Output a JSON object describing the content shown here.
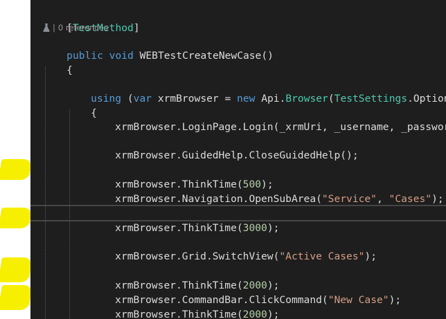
{
  "code": {
    "attribute": {
      "open": "[",
      "name": "TestMethod",
      "close": "]"
    },
    "codelens": {
      "separator": "|",
      "text": "0 references"
    },
    "signature": {
      "kw_public": "public",
      "kw_void": "void",
      "method": " WEBTestCreateNewCase()"
    },
    "brace_open_method": "{",
    "using_line": {
      "kw_using": "using",
      "p1": " (",
      "kw_var": "var",
      "p2": " xrmBrowser = ",
      "kw_new": "new",
      "p3": " Api.",
      "type_browser": "Browser",
      "p4": "(",
      "type_settings": "TestSettings",
      "p5": ".Options))"
    },
    "brace_open_using": "{",
    "lines": {
      "login": "xrmBrowser.LoginPage.Login(_xrmUri, _username, _password);",
      "guided_help": "xrmBrowser.GuidedHelp.CloseGuidedHelp();",
      "think1": {
        "pre": "xrmBrowser.ThinkTime(",
        "num": "500",
        "post": ");"
      },
      "navigation": {
        "pre": "xrmBrowser.Navigation.OpenSubArea(",
        "s1": "\"Service\"",
        "mid": ", ",
        "s2": "\"Cases\"",
        "post": ");"
      },
      "think2": {
        "pre": "xrmBrowser.ThinkTime(",
        "num": "3000",
        "post": ");"
      },
      "switch_view": {
        "pre": "xrmBrowser.Grid.SwitchView(",
        "s1": "\"Active Cases\"",
        "post": ");"
      },
      "think3": {
        "pre": "xrmBrowser.ThinkTime(",
        "num": "2000",
        "post": ");"
      },
      "click_command": {
        "pre": "xrmBrowser.CommandBar.ClickCommand(",
        "s1": "\"New Case\"",
        "post": ");"
      },
      "think4": {
        "pre": "xrmBrowser.ThinkTime(",
        "num": "2000",
        "post": ");"
      }
    }
  },
  "colors": {
    "background": "#1e1e1e",
    "keyword": "#569cd6",
    "type": "#4ec9b0",
    "string": "#d69d85",
    "number": "#b5cea8",
    "text": "#dcdcdc",
    "highlighter": "#f7ef00"
  },
  "icons": {
    "codelens": "flask-icon"
  }
}
